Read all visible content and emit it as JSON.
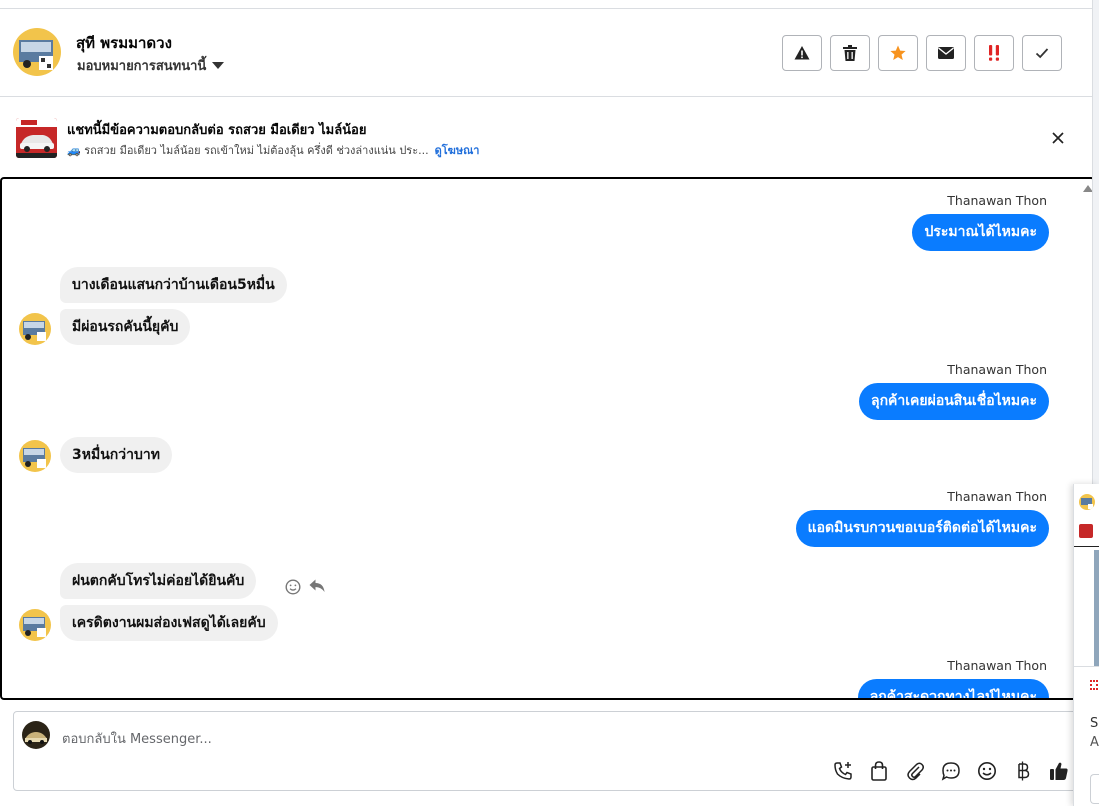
{
  "header": {
    "contact_name": "สุที พรมมาดวง",
    "assign_label": "มอบหมายการสนทนานี้",
    "actions": [
      "warning-icon",
      "trash-icon",
      "star-icon",
      "mail-icon",
      "double-exclamation-icon",
      "check-icon"
    ]
  },
  "ad": {
    "title": "แชทนี้มีข้อความตอบกลับต่อ รถสวย มือเดียว ไมล์น้อย",
    "subtitle": "🚙 รถสวย มือเดียว ไมล์น้อย รถเข้าใหม่ ไม่ต้องลุ้น ครึ่งดี ช่วงล่างแน่น ประ...",
    "link": "ดูโฆษณา"
  },
  "messages": [
    {
      "direction": "out",
      "sender": "Thanawan Thon",
      "text": "ประมาณได้ไหมคะ"
    },
    {
      "direction": "in",
      "text": "บางเดือนแสนกว่าบ้านเดือน5หมื่น"
    },
    {
      "direction": "in",
      "text": "มีผ่อนรถคันนี้ยุคับ"
    },
    {
      "direction": "out",
      "sender": "Thanawan Thon",
      "text": "ลุกค้าเคยผ่อนสินเชื่อไหมคะ"
    },
    {
      "direction": "in",
      "text": "3หมื่นกว่าบาท"
    },
    {
      "direction": "out",
      "sender": "Thanawan Thon",
      "text": "แอดมินรบกวนขอเบอร์ติดต่อได้ไหมคะ"
    },
    {
      "direction": "in",
      "text": "ฝนตกคับโทรไม่ค่อยได้ยินคับ"
    },
    {
      "direction": "in",
      "text": "เครดิตงานผมส่องเฟสดูได้เลยคับ"
    },
    {
      "direction": "out",
      "sender": "Thanawan Thon",
      "text": "ลุกค้าสะดวกทางไลน์ไหมคะ"
    }
  ],
  "composer": {
    "placeholder": "ตอบกลับใน Messenger...",
    "tools": [
      "phone-add-icon",
      "bag-icon",
      "paperclip-icon",
      "chat-bubble-icon",
      "emoji-icon",
      "baht-icon",
      "thumbs-up-icon"
    ]
  },
  "peek": {
    "line1": "Sc",
    "line2": "A"
  },
  "colors": {
    "outgoing_bubble": "#0a7cff",
    "incoming_bubble": "#f0f0f0",
    "star": "#f7931e",
    "alert": "#e02424",
    "link": "#216fdb"
  }
}
